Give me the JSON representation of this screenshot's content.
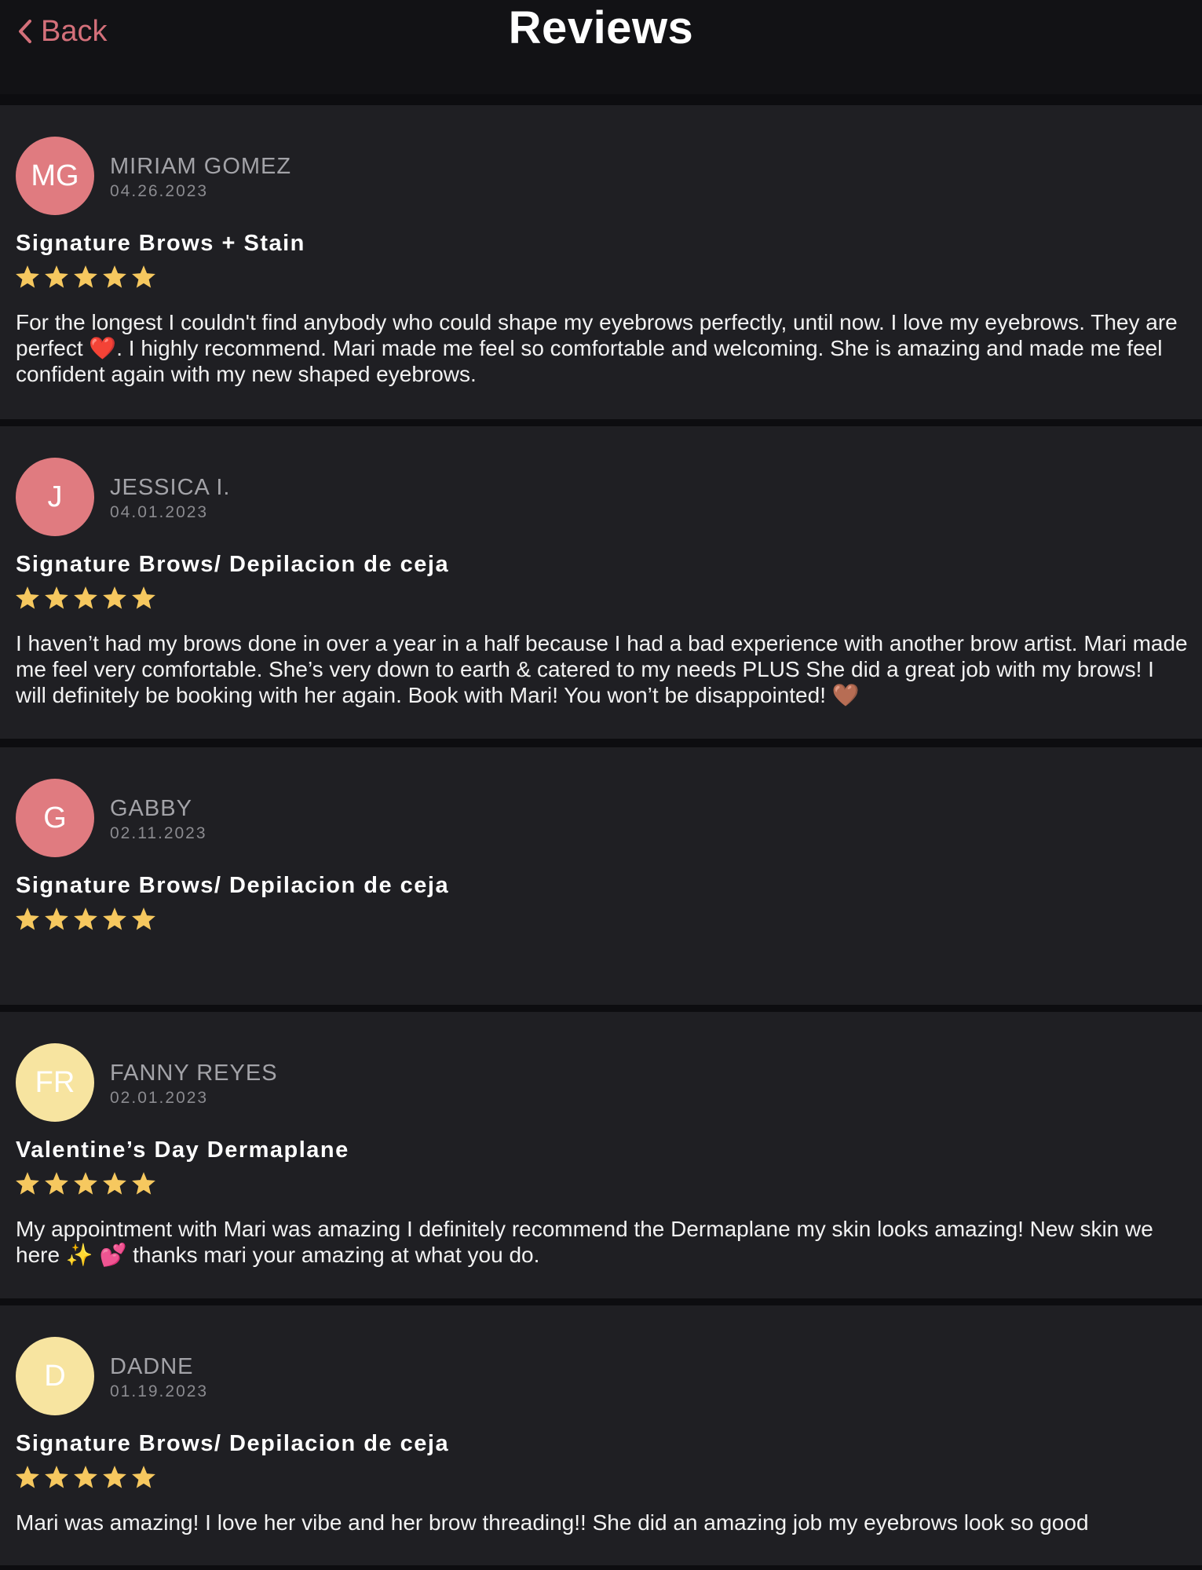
{
  "header": {
    "back_label": "Back",
    "title": "Reviews"
  },
  "colors": {
    "accent": "#d4707a",
    "star": "#f6c85f",
    "avatar_pink": "#e07b80",
    "avatar_yellow": "#f7e4a0"
  },
  "reviews": [
    {
      "initials": "MG",
      "name": "MIRIAM GOMEZ",
      "date": "04.26.2023",
      "service": "Signature Brows + Stain",
      "rating": 5,
      "text": "For the longest I couldn't find anybody who could shape my eyebrows perfectly, until now. I love my eyebrows. They are perfect ❤️. I highly recommend. Mari made me feel so comfortable and welcoming. She is amazing and made me feel confident again with my new shaped eyebrows.",
      "avatar_color": "#e07b80"
    },
    {
      "initials": "J",
      "name": "JESSICA I.",
      "date": "04.01.2023",
      "service": "Signature Brows/ Depilacion de ceja",
      "rating": 5,
      "text": "I haven’t had my brows done in over a year in a half because I had a bad experience with another brow artist.  Mari made me feel very comfortable. She’s very down to earth & catered to my needs PLUS She did a great job with my brows! I will definitely be booking with her again. Book with Mari! You won’t be disappointed! 🤎",
      "avatar_color": "#e07b80"
    },
    {
      "initials": "G",
      "name": "GABBY",
      "date": "02.11.2023",
      "service": "Signature Brows/ Depilacion de ceja",
      "rating": 5,
      "text": "",
      "avatar_color": "#e07b80"
    },
    {
      "initials": "FR",
      "name": "FANNY REYES",
      "date": "02.01.2023",
      "service": "Valentine’s Day Dermaplane",
      "rating": 5,
      "text": "My appointment with Mari was amazing I definitely recommend the Dermaplane my skin looks amazing! New skin we here ✨ 💕 thanks mari your amazing at what you do.",
      "avatar_color": "#f7e4a0"
    },
    {
      "initials": "D",
      "name": "DADNE",
      "date": "01.19.2023",
      "service": "Signature Brows/ Depilacion de ceja",
      "rating": 5,
      "text": "Mari was amazing! I love her vibe and her brow threading!! She did an amazing job my eyebrows look so good",
      "avatar_color": "#f7e4a0"
    }
  ]
}
